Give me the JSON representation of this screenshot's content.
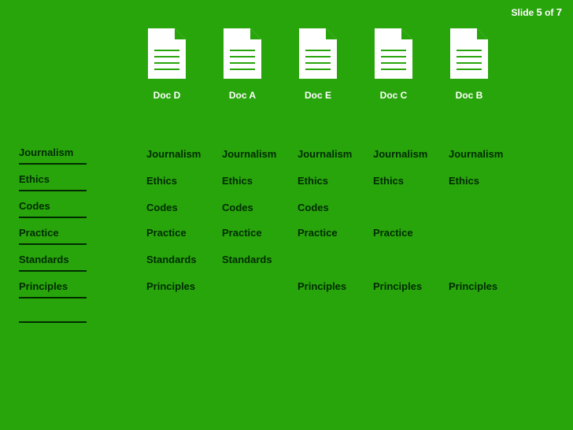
{
  "slide_counter": {
    "prefix": "Slide ",
    "current": "5",
    "sep": " of ",
    "total": "7"
  },
  "master": {
    "0": "Journalism",
    "1": "Ethics",
    "2": "Codes",
    "3": "Practice",
    "4": "Standards",
    "5": "Principles"
  },
  "columns": {
    "x": {
      "0": 186,
      "1": 282,
      "2": 378,
      "3": 474,
      "4": 570
    }
  },
  "docs": {
    "0": {
      "label": "Doc D"
    },
    "1": {
      "label": "Doc A"
    },
    "2": {
      "label": "Doc E"
    },
    "3": {
      "label": "Doc C"
    },
    "4": {
      "label": "Doc B"
    }
  },
  "rows": {
    "y": {
      "0": 188,
      "1": 222,
      "2": 256,
      "3": 288,
      "4": 322,
      "5": 356
    }
  },
  "cells": {
    "c0": {
      "0": "Journalism",
      "1": "Ethics",
      "2": "Codes",
      "3": "Practice",
      "4": "Standards",
      "5": "Principles"
    },
    "c1": {
      "0": "Journalism",
      "1": "Ethics",
      "2": "Codes",
      "3": "Practice",
      "4": "Standards"
    },
    "c2": {
      "0": "Journalism",
      "1": "Ethics",
      "2": "Codes",
      "3": "Practice",
      "5": "Principles"
    },
    "c3": {
      "0": "Journalism",
      "1": "Ethics",
      "3": "Practice",
      "5": "Principles"
    },
    "c4": {
      "0": "Journalism",
      "1": "Ethics",
      "5": "Principles"
    }
  }
}
